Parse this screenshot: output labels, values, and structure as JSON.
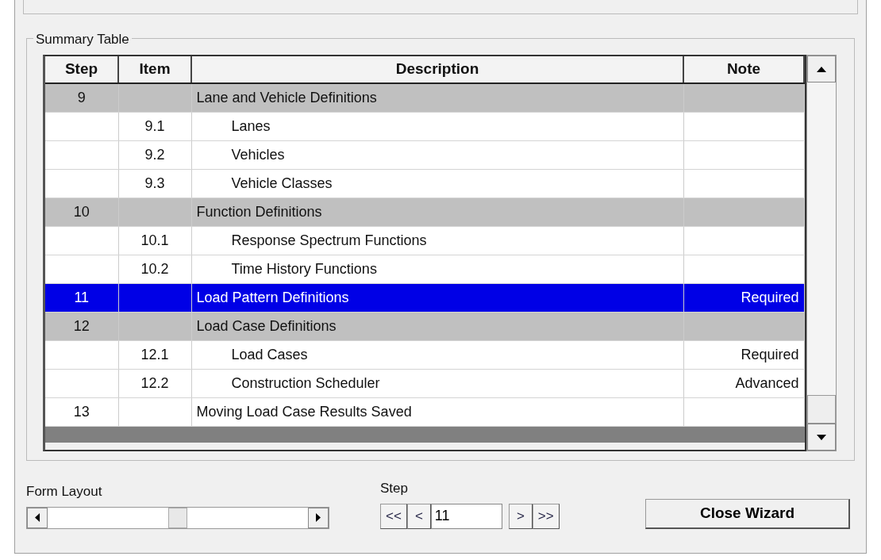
{
  "group_title": "Summary Table",
  "table": {
    "columns": [
      "Step",
      "Item",
      "Description",
      "Note"
    ],
    "rows": [
      {
        "kind": "group",
        "step": "9",
        "item": "",
        "description": "Lane and Vehicle Definitions",
        "note": "",
        "selected": false
      },
      {
        "kind": "item",
        "step": "",
        "item": "9.1",
        "description": "Lanes",
        "note": "",
        "selected": false
      },
      {
        "kind": "item",
        "step": "",
        "item": "9.2",
        "description": "Vehicles",
        "note": "",
        "selected": false
      },
      {
        "kind": "item",
        "step": "",
        "item": "9.3",
        "description": "Vehicle Classes",
        "note": "",
        "selected": false
      },
      {
        "kind": "group",
        "step": "10",
        "item": "",
        "description": "Function Definitions",
        "note": "",
        "selected": false
      },
      {
        "kind": "item",
        "step": "",
        "item": "10.1",
        "description": "Response Spectrum Functions",
        "note": "",
        "selected": false
      },
      {
        "kind": "item",
        "step": "",
        "item": "10.2",
        "description": "Time History Functions",
        "note": "",
        "selected": false
      },
      {
        "kind": "group",
        "step": "11",
        "item": "",
        "description": "Load Pattern Definitions",
        "note": "Required",
        "selected": true
      },
      {
        "kind": "group",
        "step": "12",
        "item": "",
        "description": "Load Case Definitions",
        "note": "",
        "selected": false
      },
      {
        "kind": "item",
        "step": "",
        "item": "12.1",
        "description": "Load Cases",
        "note": "Required",
        "selected": false
      },
      {
        "kind": "item",
        "step": "",
        "item": "12.2",
        "description": "Construction Scheduler",
        "note": "Advanced",
        "selected": false
      },
      {
        "kind": "plain",
        "step": "13",
        "item": "",
        "description": "Moving Load Case Results Saved",
        "note": "",
        "selected": false
      }
    ]
  },
  "form_layout": {
    "label": "Form Layout",
    "level": 0.5
  },
  "step_nav": {
    "label": "Step",
    "first": "<<",
    "prev": "<",
    "value": "11",
    "next": ">",
    "last": ">>"
  },
  "close_button": "Close Wizard"
}
